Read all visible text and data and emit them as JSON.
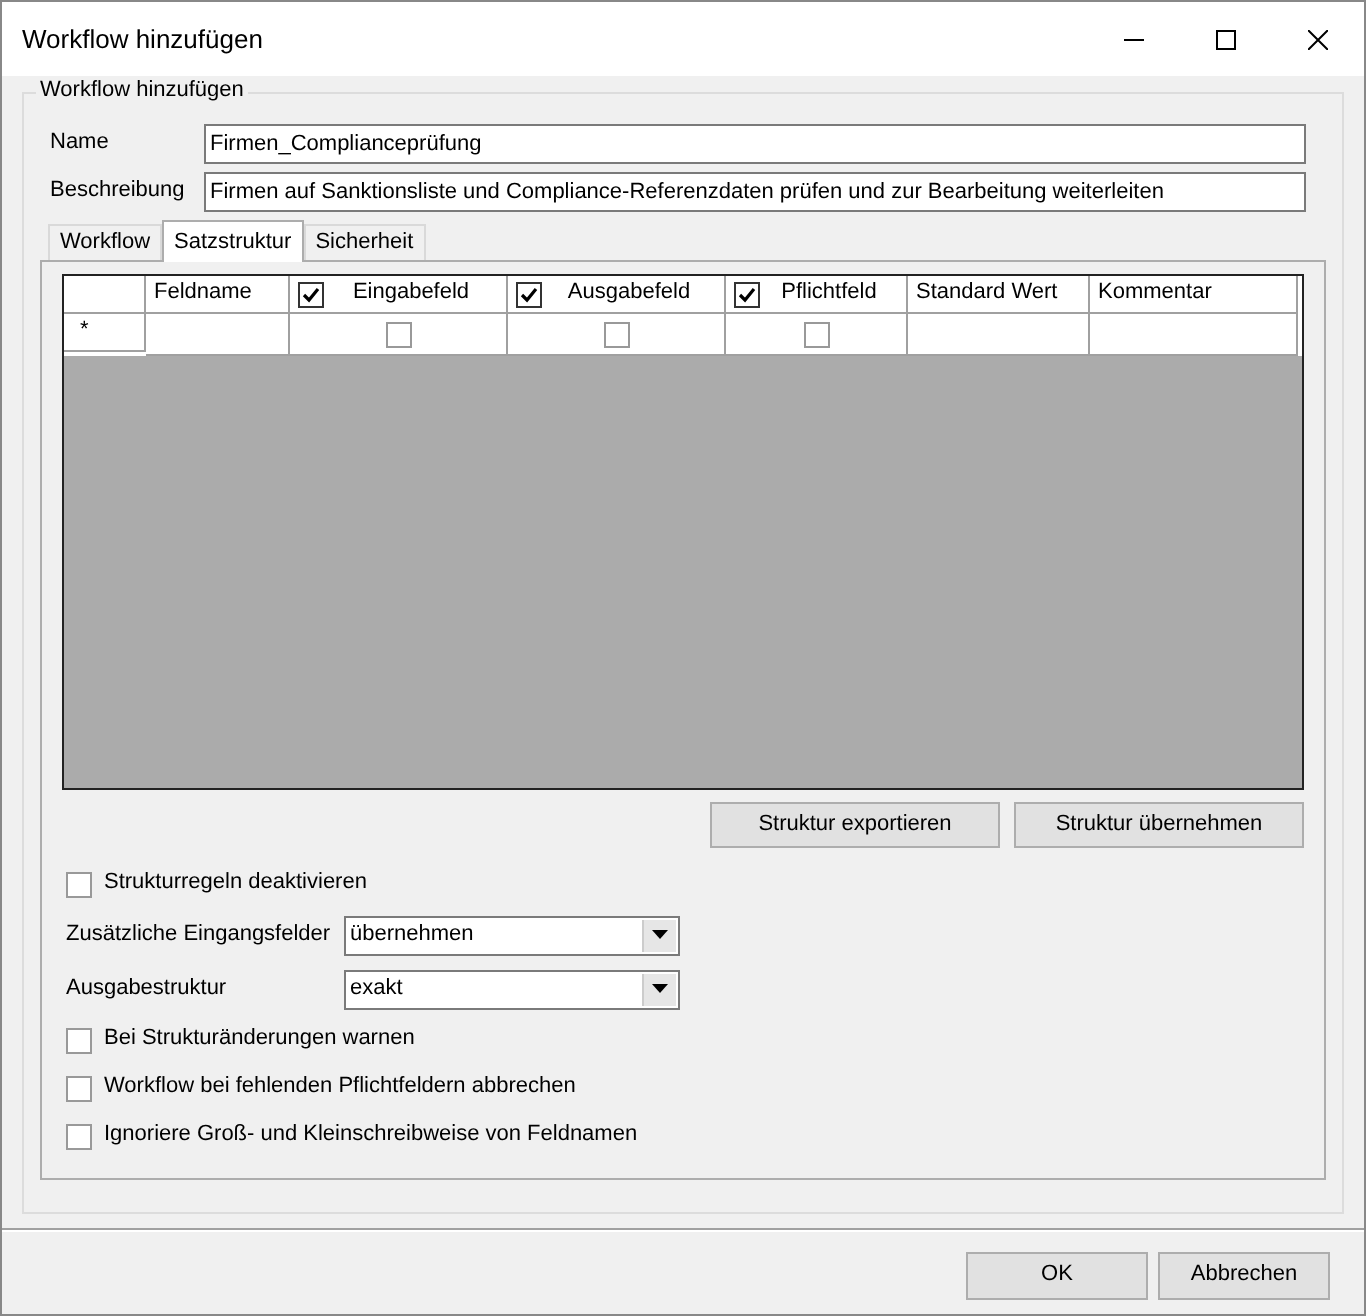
{
  "window": {
    "title": "Workflow hinzufügen"
  },
  "group": {
    "title": "Workflow hinzufügen"
  },
  "fields": [
    {
      "label": "Name",
      "value": "Firmen_Complianceprüfung"
    },
    {
      "label": "Beschreibung",
      "value": "Firmen auf Sanktionsliste und Compliance-Referenzdaten prüfen und zur Bearbeitung weiterleiten"
    }
  ],
  "tabs": [
    {
      "label": "Workflow",
      "selected": false
    },
    {
      "label": "Satzstruktur",
      "selected": true
    },
    {
      "label": "Sicherheit",
      "selected": false
    }
  ],
  "grid": {
    "columns": [
      {
        "kind": "text",
        "label": "Feldname"
      },
      {
        "kind": "check",
        "label": "Eingabefeld",
        "checked": true
      },
      {
        "kind": "check",
        "label": "Ausgabefeld",
        "checked": true
      },
      {
        "kind": "check",
        "label": "Pflichtfeld",
        "checked": true
      },
      {
        "kind": "text",
        "label": "Standard Wert"
      },
      {
        "kind": "text",
        "label": "Kommentar"
      }
    ],
    "new_row": {
      "marker": "*",
      "checks": [
        {
          "checked": false
        },
        {
          "checked": false
        },
        {
          "checked": false
        }
      ]
    }
  },
  "grid_buttons": [
    "Struktur exportieren",
    "Struktur übernehmen"
  ],
  "options": [
    {
      "kind": "checkbox",
      "label": "Strukturregeln deaktivieren",
      "checked": false
    },
    {
      "kind": "select",
      "label": "Zusätzliche Eingangsfelder",
      "value": "übernehmen"
    },
    {
      "kind": "select",
      "label": "Ausgabestruktur",
      "value": "exakt"
    },
    {
      "kind": "checkbox",
      "label": "Bei Strukturänderungen warnen",
      "checked": false
    },
    {
      "kind": "checkbox",
      "label": "Workflow bei fehlenden Pflichtfeldern abbrechen",
      "checked": false
    },
    {
      "kind": "checkbox",
      "label": "Ignoriere Groß- und Kleinschreibweise von Feldnamen",
      "checked": false
    }
  ],
  "buttons": [
    "OK",
    "Abbrechen"
  ]
}
